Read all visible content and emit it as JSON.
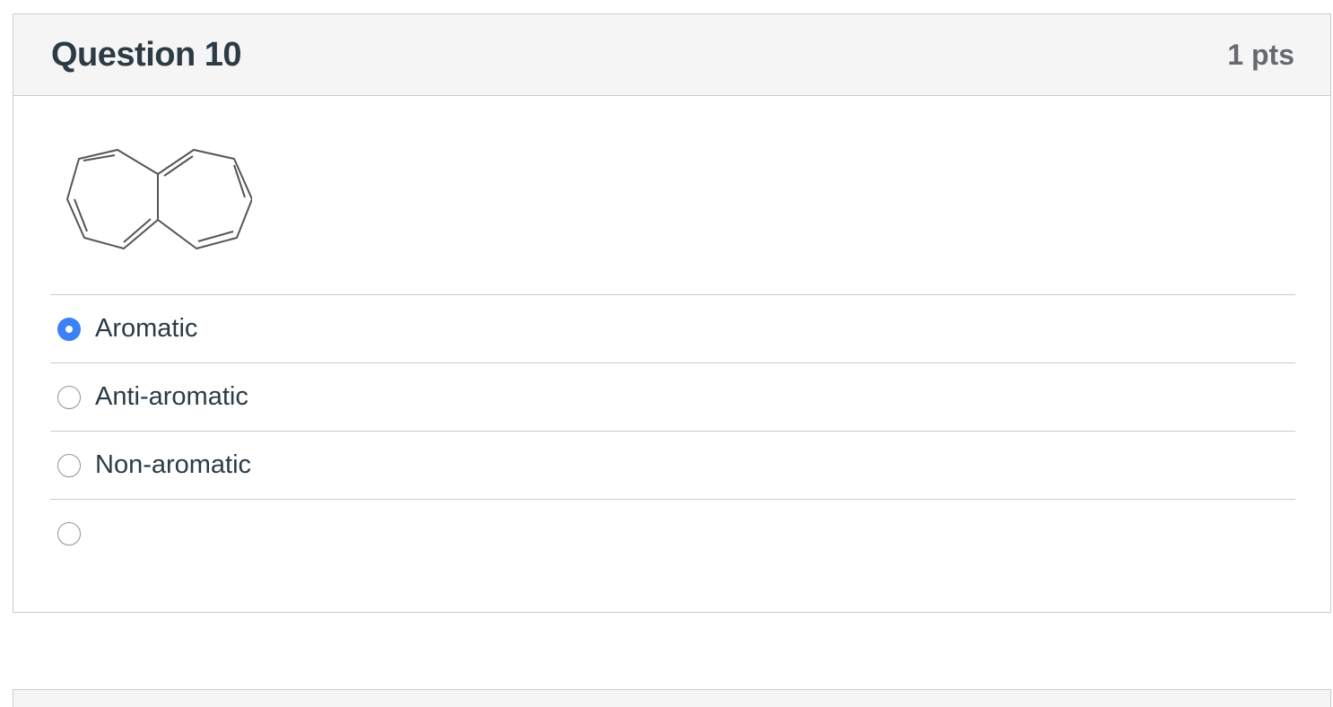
{
  "question": {
    "title": "Question 10",
    "points": "1 pts",
    "image_icon": "bicyclic-molecule-structure",
    "answers": [
      {
        "label": "Aromatic",
        "selected": true
      },
      {
        "label": "Anti-aromatic",
        "selected": false
      },
      {
        "label": "Non-aromatic",
        "selected": false
      },
      {
        "label": "",
        "selected": false
      }
    ]
  },
  "colors": {
    "header_bg": "#f5f5f5",
    "border": "#c7cdd1",
    "text": "#2d3b45",
    "points_text": "#666a6e",
    "radio_selected": "#3b82f6"
  }
}
